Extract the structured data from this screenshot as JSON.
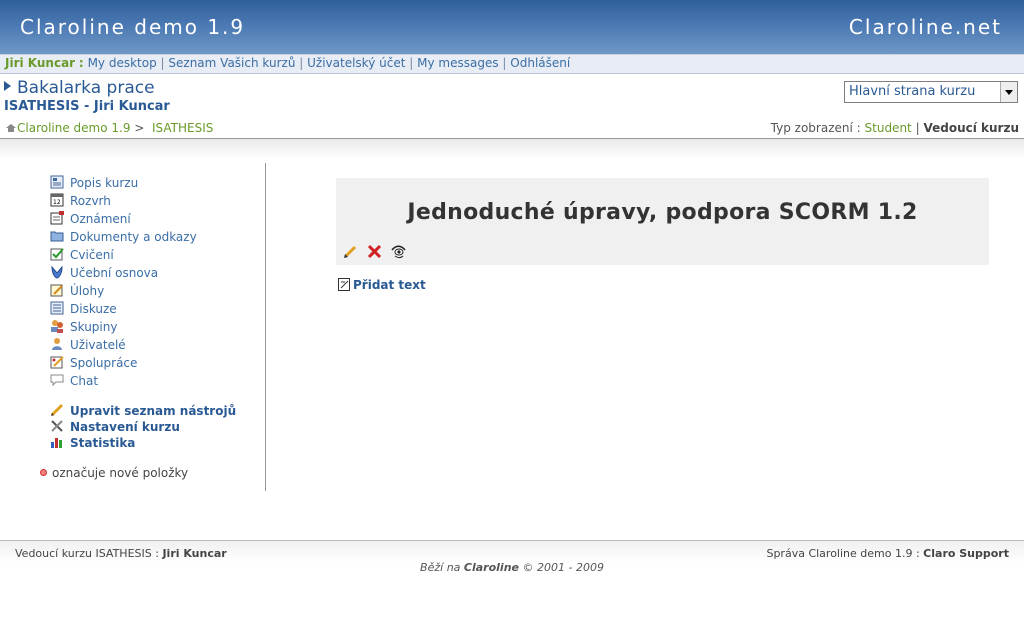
{
  "header": {
    "site_title": "Claroline demo 1.9",
    "site_link": "Claroline.net"
  },
  "userbar": {
    "user": "Jiri Kuncar",
    "colon": ":",
    "links": [
      "My desktop",
      "Seznam Vašich kurzů",
      "Uživatelský účet",
      "My messages",
      "Odhlášení"
    ]
  },
  "course": {
    "title": "Bakalarka prace",
    "code": "ISATHESIS",
    "dash": " - ",
    "holder": "Jiri Kuncar",
    "select_value": "Hlavní strana kurzu"
  },
  "breadcrumb": {
    "home": "Claroline demo 1.9",
    "sep": ">",
    "current": "ISATHESIS"
  },
  "viewmode": {
    "label": "Typ zobrazení :",
    "student": "Student",
    "sep": "|",
    "manager": "Vedoucí kurzu"
  },
  "sidebar": {
    "tools": [
      {
        "label": "Popis kurzu",
        "icon": "course-description-icon"
      },
      {
        "label": "Rozvrh",
        "icon": "calendar-icon"
      },
      {
        "label": "Oznámení",
        "icon": "announcement-icon"
      },
      {
        "label": "Dokumenty a odkazy",
        "icon": "folder-icon"
      },
      {
        "label": "Cvičení",
        "icon": "exercise-icon"
      },
      {
        "label": "Učební osnova",
        "icon": "learning-path-icon"
      },
      {
        "label": "Úlohy",
        "icon": "assignment-icon"
      },
      {
        "label": "Diskuze",
        "icon": "forum-icon"
      },
      {
        "label": "Skupiny",
        "icon": "groups-icon"
      },
      {
        "label": "Uživatelé",
        "icon": "user-icon"
      },
      {
        "label": "Spolupráce",
        "icon": "wiki-icon"
      },
      {
        "label": "Chat",
        "icon": "chat-icon"
      }
    ],
    "admin": [
      {
        "label": "Upravit seznam nástrojů",
        "icon": "pencil-icon"
      },
      {
        "label": "Nastavení kurzu",
        "icon": "tools-icon"
      },
      {
        "label": "Statistika",
        "icon": "stats-icon"
      }
    ],
    "legend": "označuje nové položky"
  },
  "main": {
    "title": "Jednoduché úpravy, podpora SCORM 1.2",
    "add_text": "Přidat text"
  },
  "footer": {
    "left_label": "Vedoucí kurzu ISATHESIS :",
    "left_name": "Jiri Kuncar",
    "right_label": "Správa Claroline demo 1.9 :",
    "right_name": "Claro Support",
    "powered_prefix": "Běží na",
    "powered_name": "Claroline",
    "powered_suffix": "© 2001 - 2009"
  },
  "colors": {
    "header_bg": "#3f6ea8",
    "link": "#3a6ea5",
    "green": "#6a9a2a"
  }
}
